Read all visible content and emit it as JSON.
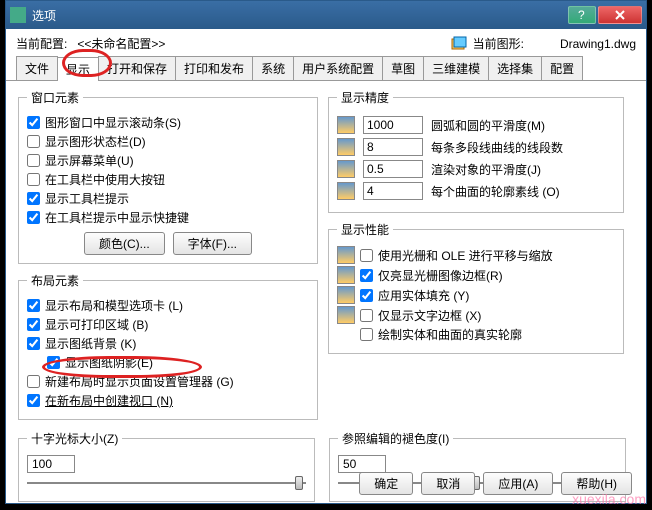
{
  "window": {
    "title": "选项"
  },
  "header": {
    "current_config_label": "当前配置:",
    "current_config_value": "<<未命名配置>>",
    "current_drawing_label": "当前图形:",
    "current_drawing_value": "Drawing1.dwg"
  },
  "tabs": {
    "t0": "文件",
    "t1": "显示",
    "t2": "打开和保存",
    "t3": "打印和发布",
    "t4": "系统",
    "t5": "用户系统配置",
    "t6": "草图",
    "t7": "三维建模",
    "t8": "选择集",
    "t9": "配置"
  },
  "window_elements": {
    "legend": "窗口元素",
    "c1": "图形窗口中显示滚动条(S)",
    "c2": "显示图形状态栏(D)",
    "c3": "显示屏幕菜单(U)",
    "c4": "在工具栏中使用大按钮",
    "c5": "显示工具栏提示",
    "c6": "在工具栏提示中显示快捷键",
    "btn_color": "颜色(C)...",
    "btn_font": "字体(F)..."
  },
  "layout_elements": {
    "legend": "布局元素",
    "c1": "显示布局和模型选项卡 (L)",
    "c2": "显示可打印区域 (B)",
    "c3": "显示图纸背景 (K)",
    "c3a": "显示图纸阴影(E)",
    "c4": "新建布局时显示页面设置管理器 (G)",
    "c5": "在新布局中创建视口 (N)"
  },
  "precision": {
    "legend": "显示精度",
    "r1_val": "1000",
    "r1_lbl": "圆弧和圆的平滑度(M)",
    "r2_val": "8",
    "r2_lbl": "每条多段线曲线的线段数",
    "r3_val": "0.5",
    "r3_lbl": "渲染对象的平滑度(J)",
    "r4_val": "4",
    "r4_lbl": "每个曲面的轮廓素线 (O)"
  },
  "performance": {
    "legend": "显示性能",
    "c1": "使用光栅和 OLE 进行平移与缩放",
    "c2": "仅亮显光栅图像边框(R)",
    "c3": "应用实体填充 (Y)",
    "c4": "仅显示文字边框 (X)",
    "c5": "绘制实体和曲面的真实轮廓"
  },
  "crosshair": {
    "legend": "十字光标大小(Z)",
    "value": "100"
  },
  "refedit": {
    "legend": "参照编辑的褪色度(I)",
    "value": "50"
  },
  "footer": {
    "ok": "确定",
    "cancel": "取消",
    "apply": "应用(A)",
    "help": "帮助(H)"
  },
  "watermark": "xuexila.com"
}
